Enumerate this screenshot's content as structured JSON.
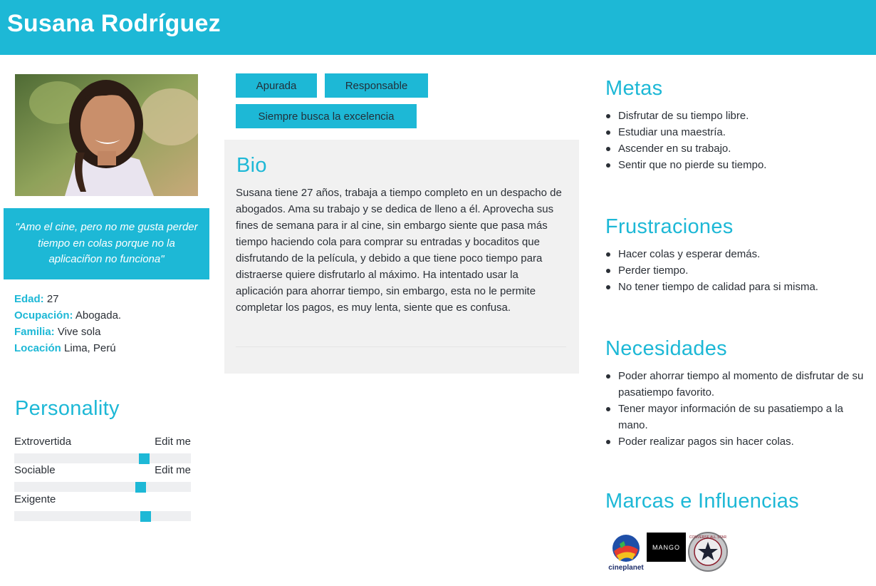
{
  "header": {
    "name": "Susana Rodríguez"
  },
  "profile": {
    "quote": "\"Amo el cine, pero no me gusta perder tiempo en colas porque no la aplicaciñon no funciona\"",
    "facts": [
      {
        "label": "Edad:",
        "value": "27"
      },
      {
        "label": "Ocupación:",
        "value": "Abogada."
      },
      {
        "label": "Familia:",
        "value": "Vive sola"
      },
      {
        "label": "Locación",
        "value": "Lima, Perú"
      }
    ]
  },
  "personality": {
    "title": "Personality",
    "traits": [
      {
        "name": "Extrovertida",
        "edit": "Edit me",
        "level": 0.75
      },
      {
        "name": "Sociable",
        "edit": "Edit me",
        "level": 0.73
      },
      {
        "name": "Exigente",
        "edit": "",
        "level": 0.76
      }
    ]
  },
  "tags": [
    "Apurada",
    "Responsable",
    "Siempre busca la excelencia"
  ],
  "bio": {
    "title": "Bio",
    "text": "Susana tiene 27 años,  trabaja a tiempo completo en un despacho de abogados. Ama su trabajo y se dedica de lleno a él. Aprovecha sus fines de semana para ir al cine, sin embargo siente que pasa más tiempo haciendo cola para comprar su entradas y bocaditos que disfrutando de la película, y debido a que tiene poco tiempo para distraerse quiere disfrutarlo al máximo. Ha intentado usar la aplicación para ahorrar tiempo, sin embargo, esta no le permite completar los pagos, es muy lenta, siente que  es confusa."
  },
  "goals": {
    "title": "Metas",
    "items": [
      "Disfrutar de su tiempo libre.",
      "Estudiar una maestría.",
      "Ascender en su trabajo.",
      "Sentir que no pierde su tiempo."
    ]
  },
  "frustrations": {
    "title": "Frustraciones",
    "items": [
      "Hacer colas y esperar demás.",
      "Perder tiempo.",
      "No tener tiempo de calidad para si misma."
    ]
  },
  "needs": {
    "title": "Necesidades",
    "items": [
      "Poder ahorrar tiempo al momento de disfrutar de su pasatiempo favorito.",
      "Tener mayor información de su pasatiempo a la mano.",
      "Poder realizar pagos sin hacer colas."
    ]
  },
  "brands": {
    "title": "Marcas e Influencias",
    "logos": [
      {
        "icon": "cineplanet-logo",
        "text": "cineplanet"
      },
      {
        "icon": "mango-logo",
        "text": "MANGO"
      },
      {
        "icon": "converse-logo",
        "text": "CONVERSE ALL STAR"
      }
    ]
  },
  "colors": {
    "accent": "#1db8d6",
    "panel": "#f1f1f1",
    "text": "#2a2f36"
  }
}
